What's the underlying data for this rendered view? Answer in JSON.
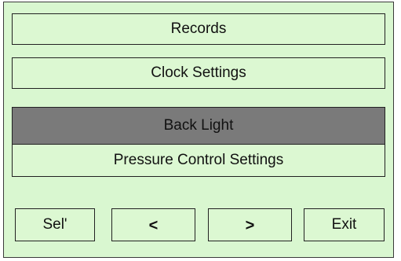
{
  "menu": {
    "items": [
      {
        "label": "Records",
        "selected": false
      },
      {
        "label": "Clock Settings",
        "selected": false
      },
      {
        "label": "Back Light",
        "selected": true
      },
      {
        "label": "Pressure Control Settings",
        "selected": false
      }
    ]
  },
  "buttons": {
    "select_label": "Sel'",
    "prev_label": "<",
    "next_label": ">",
    "exit_label": "Exit"
  },
  "colors": {
    "background": "#d9f7d0",
    "selected": "#7a7a7a",
    "border": "#222222"
  }
}
